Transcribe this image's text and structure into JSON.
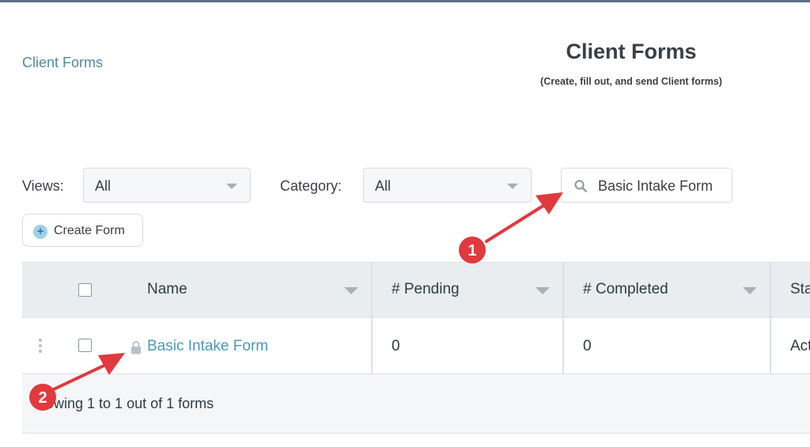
{
  "breadcrumb": "Client Forms",
  "header": {
    "title": "Client Forms",
    "subtitle": "(Create, fill out, and send Client forms)"
  },
  "filters": {
    "views_label": "Views:",
    "views_value": "All",
    "category_label": "Category:",
    "category_value": "All",
    "search_value": "Basic Intake Form"
  },
  "create_button": "Create Form",
  "table": {
    "columns": [
      "Name",
      "# Pending",
      "# Completed",
      "Sta"
    ],
    "rows": [
      {
        "name": "Basic Intake Form",
        "pending": "0",
        "completed": "0",
        "status": "Act"
      }
    ],
    "footer": "owing 1 to 1 out of 1 forms"
  },
  "annotations": [
    {
      "label": "1"
    },
    {
      "label": "2"
    }
  ],
  "colors": {
    "link": "#4a9bb5",
    "annotation_red": "#e0393e",
    "header_bg": "#e9edf0"
  }
}
